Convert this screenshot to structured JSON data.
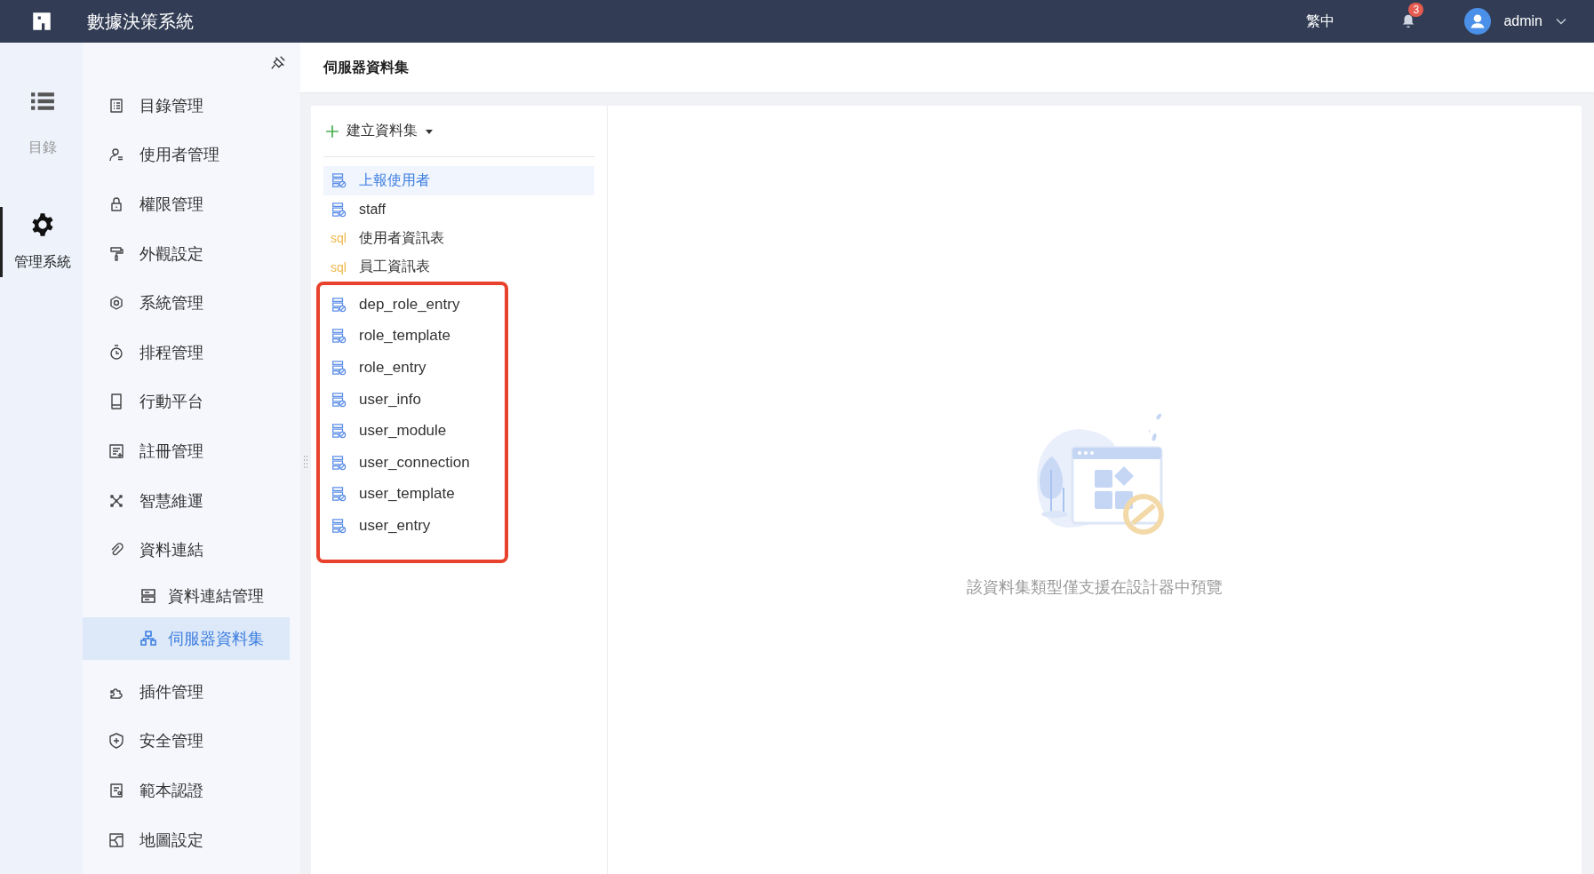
{
  "topbar": {
    "title": "數據決策系統",
    "language": "繁中",
    "notifications": "3",
    "user": "admin"
  },
  "rail": [
    {
      "label": "目錄",
      "selected": false
    },
    {
      "label": "管理系統",
      "selected": true
    }
  ],
  "menu": [
    {
      "label": "目錄管理",
      "selected": false
    },
    {
      "label": "使用者管理",
      "selected": false
    },
    {
      "label": "權限管理",
      "selected": false
    },
    {
      "label": "外觀設定",
      "selected": false
    },
    {
      "label": "系統管理",
      "selected": false
    },
    {
      "label": "排程管理",
      "selected": false
    },
    {
      "label": "行動平台",
      "selected": false
    },
    {
      "label": "註冊管理",
      "selected": false
    },
    {
      "label": "智慧維運",
      "selected": false
    },
    {
      "label": "資料連結",
      "selected": false,
      "children": [
        {
          "label": "資料連結管理",
          "selected": false
        },
        {
          "label": "伺服器資料集",
          "selected": true
        }
      ]
    },
    {
      "label": "插件管理",
      "selected": false
    },
    {
      "label": "安全管理",
      "selected": false
    },
    {
      "label": "範本認證",
      "selected": false
    },
    {
      "label": "地圖設定",
      "selected": false
    }
  ],
  "page_title": "伺服器資料集",
  "create_button": "建立資料集",
  "datasets": [
    {
      "name": "上報使用者",
      "kind": "table",
      "selected": true
    },
    {
      "name": "staff",
      "kind": "table",
      "selected": false
    },
    {
      "name": "使用者資訊表",
      "kind": "sql",
      "type_label": "sql",
      "selected": false
    },
    {
      "name": "員工資訊表",
      "kind": "sql",
      "type_label": "sql",
      "selected": false
    }
  ],
  "highlighted_datasets": [
    {
      "name": "dep_role_entry",
      "kind": "table",
      "selected": false
    },
    {
      "name": "role_template",
      "kind": "table",
      "selected": false
    },
    {
      "name": "role_entry",
      "kind": "table",
      "selected": false
    },
    {
      "name": "user_info",
      "kind": "table",
      "selected": false
    },
    {
      "name": "user_module",
      "kind": "table",
      "selected": false
    },
    {
      "name": "user_connection",
      "kind": "table",
      "selected": false
    },
    {
      "name": "user_template",
      "kind": "table",
      "selected": false
    },
    {
      "name": "user_entry",
      "kind": "table",
      "selected": false
    }
  ],
  "preview_message": "該資料集類型僅支援在設計器中預覽"
}
